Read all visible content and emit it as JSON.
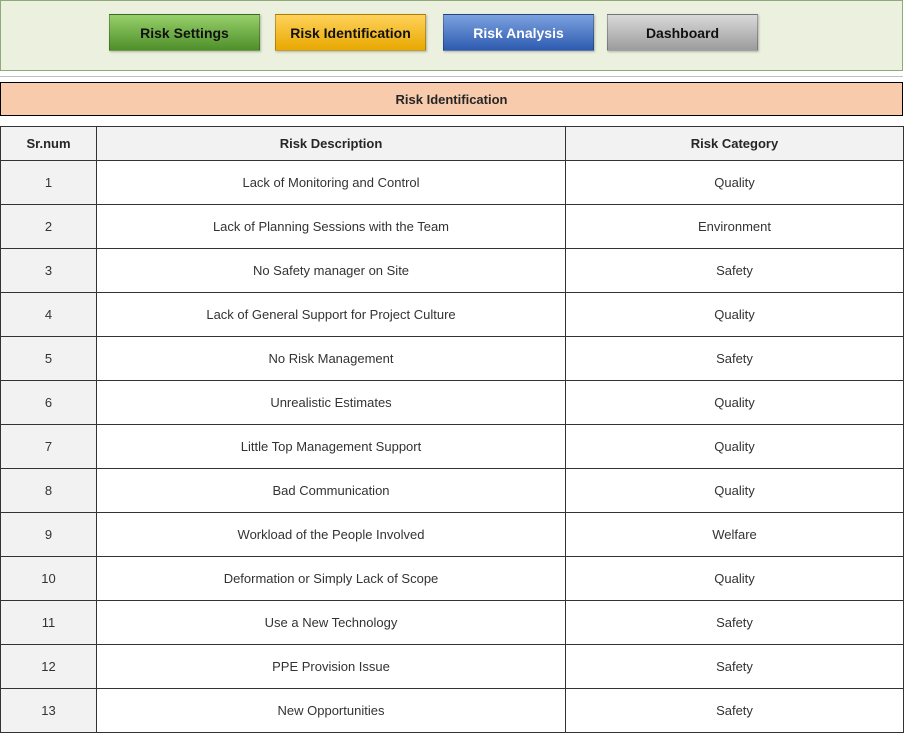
{
  "nav": {
    "buttons": [
      {
        "label": "Risk Settings",
        "color": "#5a9e33"
      },
      {
        "label": "Risk Identification",
        "color": "#f2b705"
      },
      {
        "label": "Risk Analysis",
        "color": "#3a68bd"
      },
      {
        "label": "Dashboard",
        "color": "#b3b3b3"
      }
    ]
  },
  "section": {
    "title": "Risk Identification",
    "color": "#f8cbad"
  },
  "table": {
    "headers": [
      "Sr.num",
      "Risk Description",
      "Risk Category"
    ],
    "rows": [
      {
        "num": "1",
        "description": "Lack of Monitoring and Control",
        "category": "Quality"
      },
      {
        "num": "2",
        "description": "Lack of Planning Sessions with the Team",
        "category": "Environment"
      },
      {
        "num": "3",
        "description": "No Safety manager on Site",
        "category": "Safety"
      },
      {
        "num": "4",
        "description": "Lack of General Support for Project Culture",
        "category": "Quality"
      },
      {
        "num": "5",
        "description": "No Risk Management",
        "category": "Safety"
      },
      {
        "num": "6",
        "description": "Unrealistic Estimates",
        "category": "Quality"
      },
      {
        "num": "7",
        "description": "Little Top Management Support",
        "category": "Quality"
      },
      {
        "num": "8",
        "description": "Bad Communication",
        "category": "Quality"
      },
      {
        "num": "9",
        "description": "Workload of the People Involved",
        "category": "Welfare"
      },
      {
        "num": "10",
        "description": "Deformation or Simply Lack of Scope",
        "category": "Quality"
      },
      {
        "num": "11",
        "description": "Use a New Technology",
        "category": "Safety"
      },
      {
        "num": "12",
        "description": "PPE Provision Issue",
        "category": "Safety"
      },
      {
        "num": "13",
        "description": "New Opportunities",
        "category": "Safety"
      }
    ]
  }
}
